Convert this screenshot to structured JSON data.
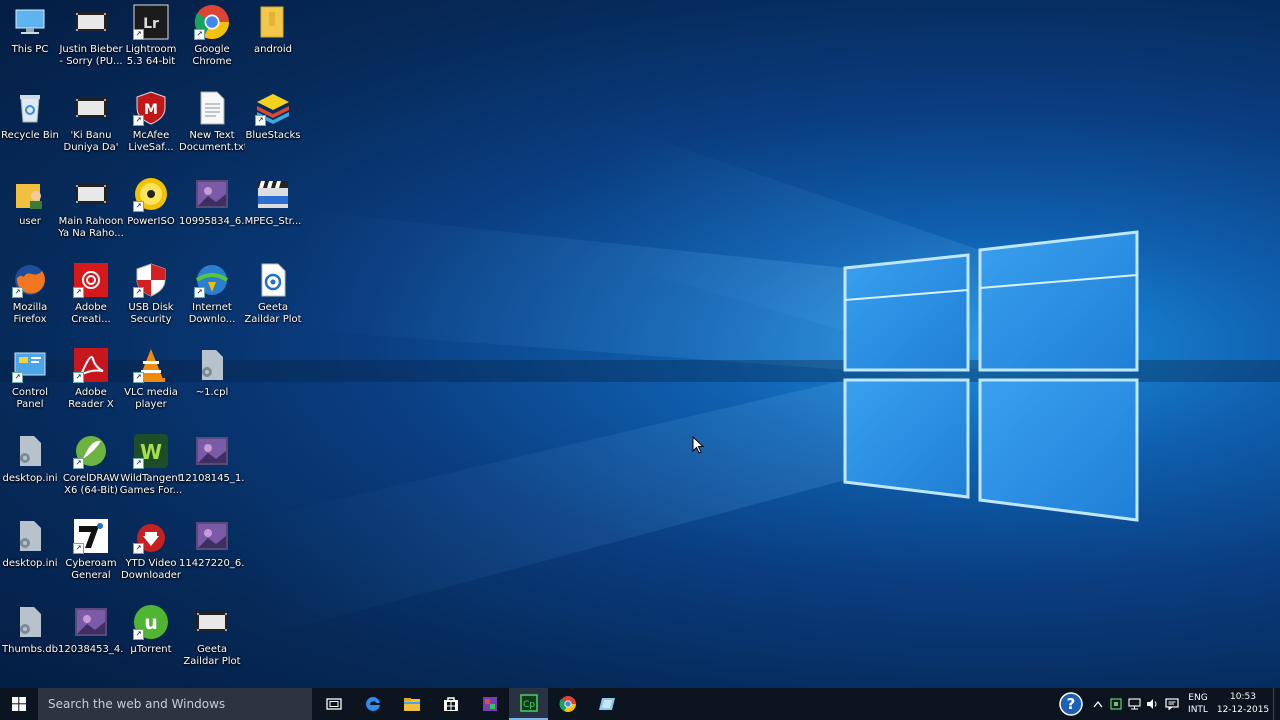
{
  "desktop": {
    "icons": [
      {
        "label": "This PC",
        "icon": "this-pc-icon"
      },
      {
        "label": "Recycle Bin",
        "icon": "recycle-bin-icon"
      },
      {
        "label": "user",
        "icon": "user-folder-icon"
      },
      {
        "label": "Mozilla Firefox",
        "icon": "firefox-icon"
      },
      {
        "label": "Control Panel",
        "icon": "control-panel-icon"
      },
      {
        "label": "desktop.ini",
        "icon": "settings-file-icon"
      },
      {
        "label": "desktop.ini",
        "icon": "settings-file-icon"
      },
      {
        "label": "Thumbs.db",
        "icon": "settings-file-icon"
      },
      {
        "label": "Justin Bieber - Sorry (PU...",
        "icon": "video-file-icon"
      },
      {
        "label": "'Ki Banu Duniya Da' ...",
        "icon": "video-file-icon"
      },
      {
        "label": "Main Rahoon Ya Na Raho...",
        "icon": "video-file-icon"
      },
      {
        "label": "Adobe Creati...",
        "icon": "adobe-cc-icon"
      },
      {
        "label": "Adobe Reader X",
        "icon": "adobe-reader-icon"
      },
      {
        "label": "CorelDRAW X6 (64-Bit)",
        "icon": "coreldraw-icon"
      },
      {
        "label": "Cyberoam General Aut...",
        "icon": "cyberoam-icon"
      },
      {
        "label": "12038453_4...",
        "icon": "image-file-icon"
      },
      {
        "label": "Lightroom 5.3 64-bit",
        "icon": "lightroom-icon"
      },
      {
        "label": "McAfee LiveSaf...",
        "icon": "mcafee-icon"
      },
      {
        "label": "PowerISO",
        "icon": "poweriso-icon"
      },
      {
        "label": "USB Disk Security",
        "icon": "usb-security-icon"
      },
      {
        "label": "VLC media player",
        "icon": "vlc-icon"
      },
      {
        "label": "WildTangent Games For...",
        "icon": "wildtangent-icon"
      },
      {
        "label": "YTD Video Downloader",
        "icon": "ytd-icon"
      },
      {
        "label": "µTorrent",
        "icon": "utorrent-icon"
      },
      {
        "label": "Google Chrome",
        "icon": "chrome-icon"
      },
      {
        "label": "New Text Document.txt",
        "icon": "text-file-icon"
      },
      {
        "label": "10995834_6...",
        "icon": "image-file-icon"
      },
      {
        "label": "Internet Downlo...",
        "icon": "idm-icon"
      },
      {
        "label": "~1.cpl",
        "icon": "settings-file-icon"
      },
      {
        "label": "12108145_1...",
        "icon": "image-file-icon"
      },
      {
        "label": "11427220_6...",
        "icon": "image-file-icon"
      },
      {
        "label": "Geeta Zaildar Plot Full Vid...",
        "icon": "video-file-icon"
      },
      {
        "label": "android",
        "icon": "folder-icon"
      },
      {
        "label": "BlueStacks",
        "icon": "bluestacks-icon"
      },
      {
        "label": "MPEG_Str...",
        "icon": "video-clapper-icon"
      },
      {
        "label": "Geeta Zaildar Plot Full Vid...",
        "icon": "media-file-icon"
      }
    ]
  },
  "taskbar": {
    "search_placeholder": "Search the web and Windows",
    "apps": [
      "task-view-icon",
      "edge-icon",
      "file-explorer-icon",
      "store-icon",
      "app-icon",
      "captivate-icon",
      "chrome-icon",
      "app-icon"
    ],
    "tray": {
      "lang_top": "ENG",
      "lang_bottom": "INTL",
      "time": "10:53",
      "date": "12-12-2015"
    }
  },
  "colors": {
    "taskbar": "#0c1420",
    "search": "#2b3440",
    "accent": "#7cb3e8"
  }
}
